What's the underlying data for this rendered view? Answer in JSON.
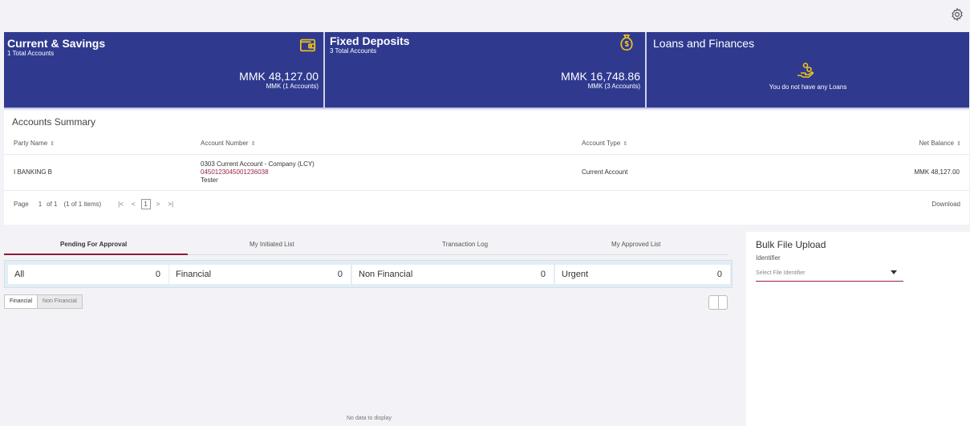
{
  "icons": {
    "settings": "gear-icon",
    "wallet": "wallet-icon",
    "money_bag": "money-bag-icon",
    "loan": "hand-coins-icon"
  },
  "colors": {
    "brand_navy": "#2f3a8f",
    "accent_maroon": "#9b2341"
  },
  "cards": {
    "current_savings": {
      "title": "Current & Savings",
      "subtitle": "1 Total Accounts",
      "amount": "MMK 48,127.00",
      "amount_sub": "MMK (1 Accounts)"
    },
    "fixed_deposits": {
      "title": "Fixed Deposits",
      "subtitle": "3 Total Accounts",
      "amount": "MMK 16,748.86",
      "amount_sub": "MMK (3 Accounts)"
    },
    "loans": {
      "title": "Loans and Finances",
      "message": "You do not have any Loans"
    }
  },
  "accounts_summary": {
    "title": "Accounts Summary",
    "columns": {
      "party_name": "Party Name",
      "account_number": "Account Number",
      "account_type": "Account Type",
      "net_balance": "Net Balance"
    },
    "sort_glyph": "⇕",
    "rows": [
      {
        "party_name": "I BANKING B",
        "account_desc": "0303 Current Account - Company (LCY)",
        "account_number": "0450123045001236038",
        "account_holder": "Tester",
        "account_type": "Current Account",
        "net_balance": "MMK 48,127.00"
      }
    ],
    "pager": {
      "page_label": "Page",
      "page": "1",
      "of": "of 1",
      "items": "(1 of 1 items)",
      "first": "|<",
      "prev": "<",
      "current": "1",
      "next": ">",
      "last": ">|"
    },
    "download_label": "Download"
  },
  "approvals": {
    "tabs": [
      "Pending For Approval",
      "My Initiated List",
      "Transaction Log",
      "My Approved List"
    ],
    "counters": [
      {
        "label": "All",
        "count": "0"
      },
      {
        "label": "Financial",
        "count": "0"
      },
      {
        "label": "Non Financial",
        "count": "0"
      },
      {
        "label": "Urgent",
        "count": "0"
      }
    ],
    "segments": [
      "Financial",
      "Non Financial"
    ],
    "no_data": "No data to display"
  },
  "bulk_upload": {
    "title": "Bulk File Upload",
    "identifier_label": "Identifier",
    "select_placeholder": "Select File Identifier"
  }
}
